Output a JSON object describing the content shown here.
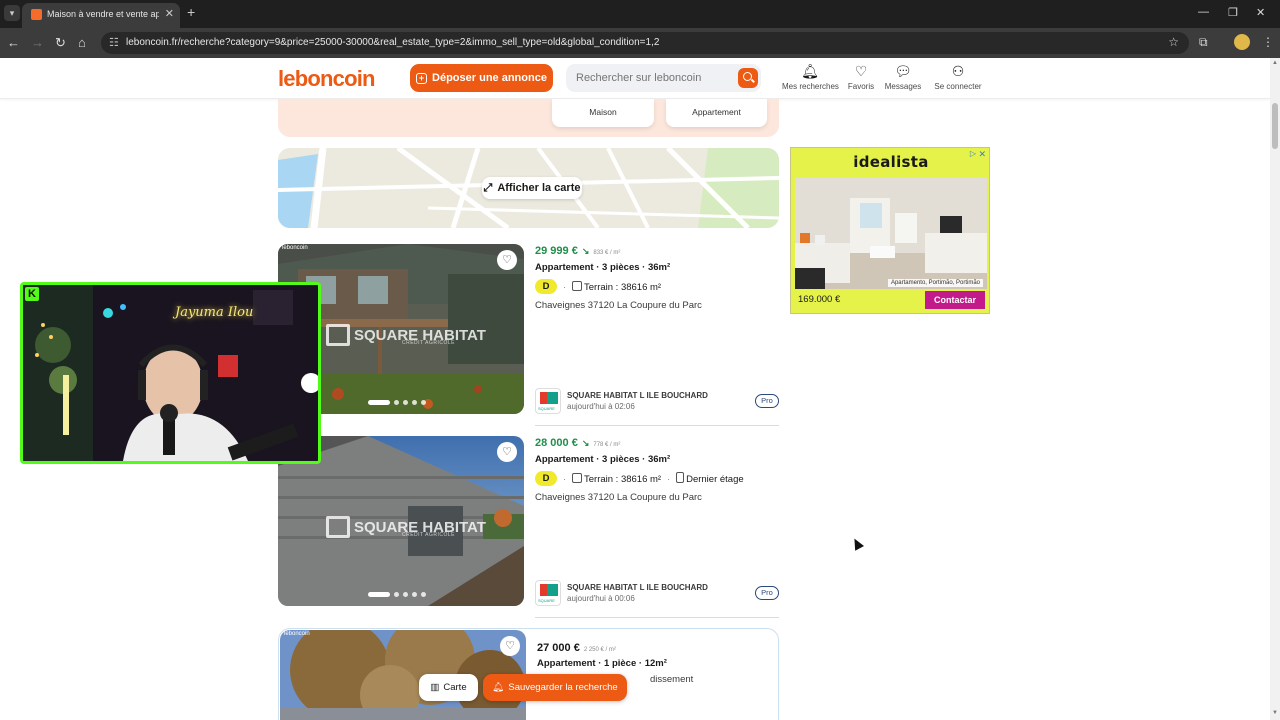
{
  "browser": {
    "tab_title": "Maison à vendre et vente appa",
    "url": "leboncoin.fr/recherche?category=9&price=25000-30000&real_estate_type=2&immo_sell_type=old&global_condition=1,2"
  },
  "header": {
    "logo": "leboncoin",
    "deposit_button": "Déposer une annonce",
    "search_placeholder": "Rechercher sur leboncoin",
    "nav": [
      {
        "label": "Mes recherches",
        "icon": "bell-icon"
      },
      {
        "label": "Favoris",
        "icon": "heart-icon"
      },
      {
        "label": "Messages",
        "icon": "chat-icon"
      },
      {
        "label": "Se connecter",
        "icon": "user-icon"
      }
    ]
  },
  "category_cards": [
    "Maison",
    "Appartement"
  ],
  "map": {
    "button": "Afficher la carte"
  },
  "listings": [
    {
      "price": "29 999 €",
      "price_per_m2": "833 € / m²",
      "title": "Appartement · 3 pièces · 36m²",
      "energy_class": "D",
      "land": "Terrain : 38616 m²",
      "floor": "",
      "location": "Chaveignes 37120 La Coupure du Parc",
      "seller": "SQUARE HABITAT L ILE BOUCHARD",
      "posted": "aujourd'hui à 02:06",
      "badge": "Pro",
      "watermark": "SQUARE HABITAT",
      "watermark_sub": "CRÉDIT AGRICOLE",
      "photo_count": 5
    },
    {
      "price": "28 000 €",
      "price_per_m2": "778 € / m²",
      "title": "Appartement · 3 pièces · 36m²",
      "energy_class": "D",
      "land": "Terrain : 38616 m²",
      "floor": "Dernier étage",
      "location": "Chaveignes 37120 La Coupure du Parc",
      "seller": "SQUARE HABITAT L ILE BOUCHARD",
      "posted": "aujourd'hui à 00:06",
      "badge": "Pro",
      "watermark": "SQUARE HABITAT",
      "watermark_sub": "CRÉDIT AGRICOLE",
      "photo_count": 5
    },
    {
      "price": "27 000 €",
      "price_per_m2": "2 250 € / m²",
      "title": "Appartement · 1 pièce · 12m²",
      "location_fragment": "dissement"
    }
  ],
  "bottom_bar": {
    "map_button": "Carte",
    "save_button": "Sauvegarder la recherche"
  },
  "ad": {
    "brand": "idealista",
    "caption": "Apartamento, Portimão, Portimão",
    "price": "169.000 €",
    "cta": "Contactar"
  },
  "webcam": {
    "platform_icon": "K",
    "neon_sign": "Jayuma Ilou"
  },
  "colors": {
    "brand_orange": "#ec5a13",
    "price_green": "#1f8f4a",
    "ad_yellow": "#e4f249",
    "ad_cta": "#c21a8b",
    "kick_green": "#53fc18"
  }
}
